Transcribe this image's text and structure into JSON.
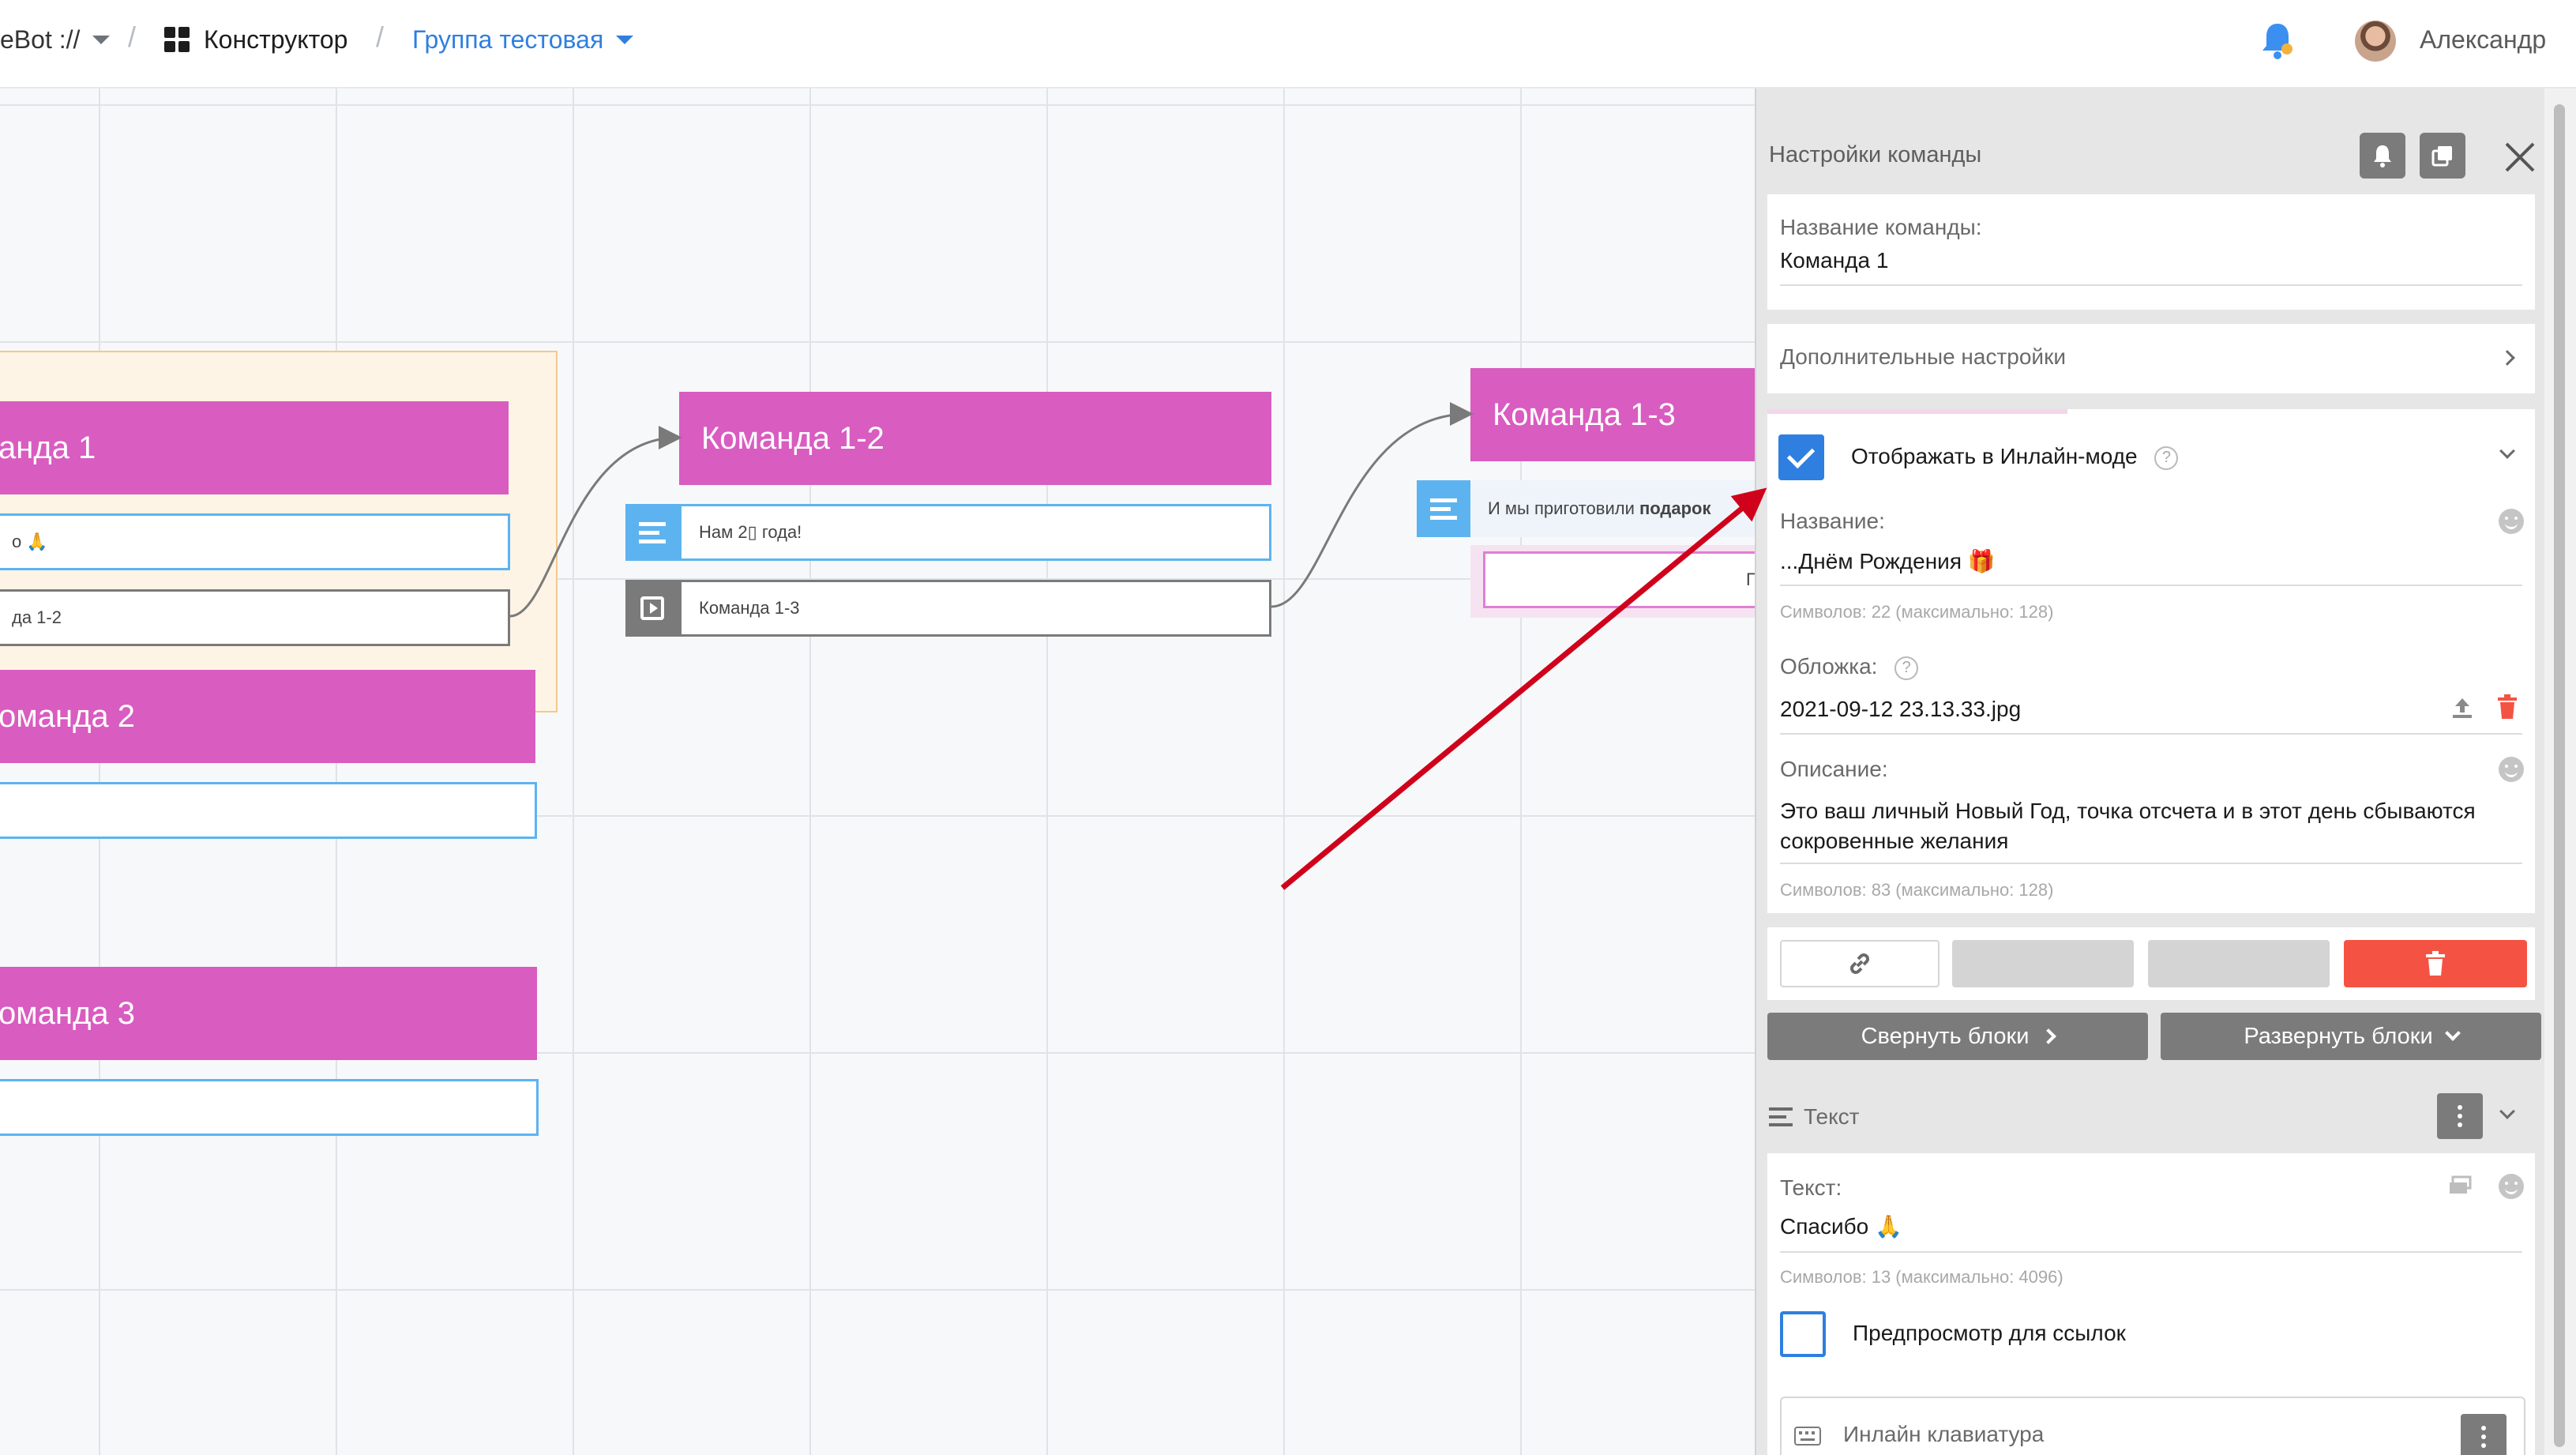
{
  "topbar": {
    "app_name": "eBot ://",
    "separator": "/",
    "constructor_label": "Конструктор",
    "group_label": "Группа тестовая",
    "user_name": "Александр",
    "colors": {
      "link": "#2f7fe0",
      "bell": "#3b8ff0",
      "bell_dot": "#f2b33d"
    }
  },
  "canvas": {
    "nodes": [
      {
        "title": "анда 1",
        "rows": [
          "о 🙏",
          "да 1-2"
        ]
      },
      {
        "title": "оманда 2",
        "rows": [
          ""
        ]
      },
      {
        "title": "оманда 3",
        "rows": [
          ""
        ]
      },
      {
        "title": "Команда 1-2",
        "rows": [
          "Нам 2▯ года!",
          "Команда 1-3"
        ]
      },
      {
        "title": "Команда 1-3",
        "rows_prefix": "И мы приготовили ",
        "rows_bold": "подарок",
        "button_label": "По"
      }
    ],
    "colors": {
      "node_head": "#d95cc0",
      "text_row_border": "#5db3f0",
      "link_row_border": "#7a7a7a",
      "group_fill": "#fdf4e6",
      "arrow": "#d0021b"
    }
  },
  "panel": {
    "title": "Настройки команды",
    "name_field": {
      "label": "Название команды:",
      "value": "Команда 1"
    },
    "extra_settings": "Дополнительные настройки",
    "inline_mode": {
      "checkbox_label": "Отображать в Инлайн-моде",
      "checked": true,
      "name_label": "Название:",
      "name_value": "...Днём Рождения 🎁",
      "name_hint": "Символов: 22 (максимально: 128)",
      "cover_label": "Обложка:",
      "cover_value": "2021-09-12 23.13.33.jpg",
      "desc_label": "Описание:",
      "desc_value": "Это ваш личный Новый Год, точка отсчета и в этот день сбываются сокровенные желания",
      "desc_hint": "Символов: 83 (максимально: 128)"
    },
    "collapse_label": "Свернуть блоки",
    "expand_label": "Развернуть блоки",
    "text_block": {
      "header": "Текст",
      "text_label": "Текст:",
      "text_value": "Спасибо 🙏",
      "text_hint": "Символов: 13 (максимально: 4096)",
      "preview_label": "Предпросмотр для ссылок",
      "preview_checked": false,
      "keyboard_label": "Инлайн клавиатура"
    },
    "colors": {
      "delete": "#f45343",
      "checkbox": "#2f7fe0",
      "button_gray": "#7b7b7b"
    }
  }
}
